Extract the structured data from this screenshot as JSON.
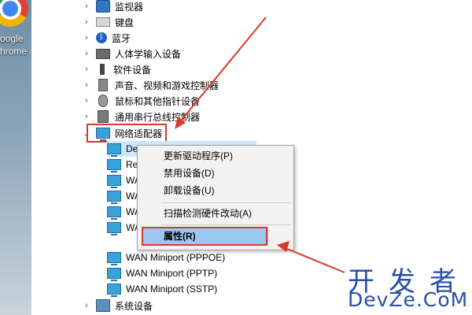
{
  "desktop": {
    "icon_line1": "oogle",
    "icon_line2": "hrome"
  },
  "tree": {
    "categories_top": [
      {
        "label": "监视器",
        "icon": "monitor-icon"
      },
      {
        "label": "键盘",
        "icon": "keyboard-icon"
      },
      {
        "label": "蓝牙",
        "icon": "bluetooth-icon"
      },
      {
        "label": "人体学输入设备",
        "icon": "hid-icon"
      },
      {
        "label": "软件设备",
        "icon": "software-device-icon"
      },
      {
        "label": "声音、视频和游戏控制器",
        "icon": "sound-icon"
      },
      {
        "label": "鼠标和其他指针设备",
        "icon": "mouse-icon"
      },
      {
        "label": "通用串行总线控制器",
        "icon": "usb-icon"
      }
    ],
    "network_adapters": {
      "label": "网络适配器",
      "expanded": true,
      "children": [
        {
          "label": "De"
        },
        {
          "label": "Re"
        },
        {
          "label": "WA"
        },
        {
          "label": "WA"
        },
        {
          "label": "WA"
        },
        {
          "label": "WA"
        },
        {
          "label": "WAN Miniport (PPPOE)"
        },
        {
          "label": "WAN Miniport (PPTP)"
        },
        {
          "label": "WAN Miniport (SSTP)"
        }
      ]
    },
    "system_devices": {
      "label": "系统设备"
    }
  },
  "context_menu": {
    "items": [
      {
        "label": "更新驱动程序(P)"
      },
      {
        "label": "禁用设备(D)"
      },
      {
        "label": "卸载设备(U)"
      },
      {
        "label": "扫描检测硬件改动(A)"
      },
      {
        "label": "属性(R)",
        "selected": true
      }
    ]
  },
  "watermark": {
    "top": "开发者",
    "bottom": "DevZe.CoM"
  },
  "colors": {
    "highlight_box": "#d93a2b",
    "menu_selected": "#99c9ef",
    "watermark": "#2a4fa8"
  }
}
